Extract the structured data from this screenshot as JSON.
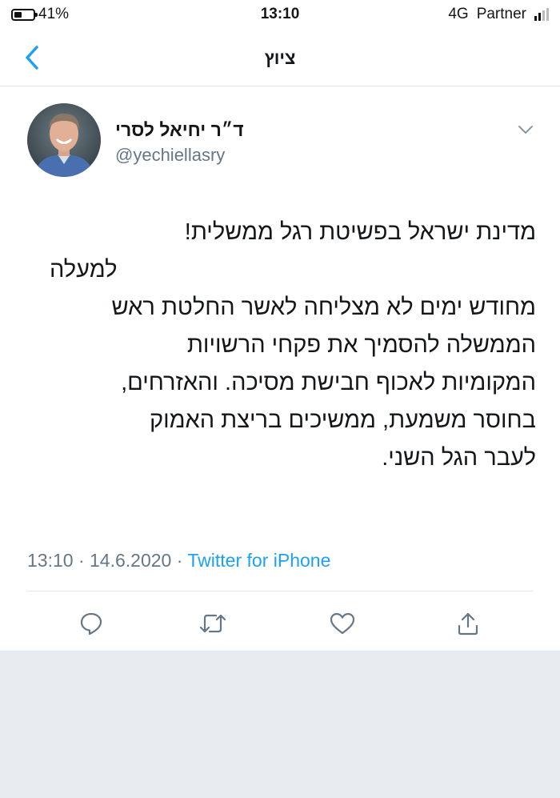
{
  "status_bar": {
    "battery_text": "41%",
    "battery_level": 0.41,
    "time": "13:10",
    "network": "4G",
    "carrier": "Partner"
  },
  "nav": {
    "title": "ציוץ",
    "back_icon": "chevron-left-icon"
  },
  "tweet": {
    "author_name": "ד״ר יחיאל לסרי",
    "author_handle": "@yechiellasry",
    "lines": [
      "מדינת ישראל בפשיטת רגל ממשלית!",
      "למעלה",
      "מחודש ימים לא מצליחה לאשר החלטת ראש",
      "הממשלה להסמיך את פקחי הרשויות",
      "המקומיות לאכוף חבישת מסיכה. והאזרחים,",
      "בחוסר משמעת, ממשיכים בריצת האמוק",
      "לעבר הגל השני."
    ],
    "time": "13:10",
    "date": "14.6.2020",
    "separator": "·",
    "source": "Twitter for iPhone"
  },
  "actions": {
    "icons": [
      "reply-icon",
      "retweet-icon",
      "like-icon",
      "share-icon"
    ]
  },
  "colors": {
    "accent": "#1da1f2",
    "secondary_text": "#657786",
    "icon": "#657786"
  }
}
